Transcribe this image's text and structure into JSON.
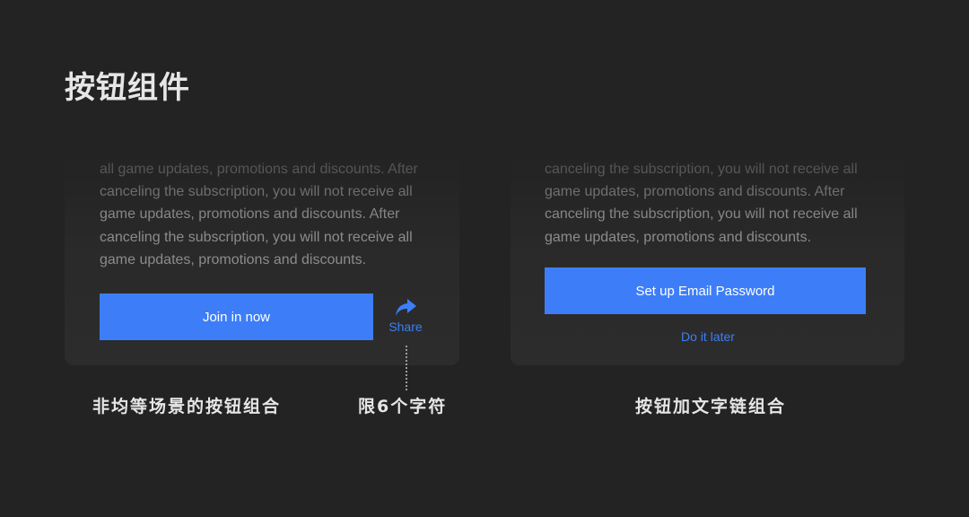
{
  "page": {
    "title": "按钮组件"
  },
  "left_card": {
    "body_lines": [
      "all game updates, promotions and discounts. After",
      "canceling the subscription, you will not receive all",
      "game updates, promotions and discounts. After",
      "canceling the subscription, you will not receive all",
      "game updates, promotions and discounts."
    ],
    "primary_button_label": "Join in now",
    "share_label": "Share",
    "share_icon": "share-arrow-icon"
  },
  "right_card": {
    "body_lines": [
      "canceling the subscription, you will not receive all",
      "game updates, promotions and discounts. After",
      "canceling the subscription, you will not receive all",
      "game updates, promotions and discounts."
    ],
    "primary_button_label": "Set up Email Password",
    "text_link_label": "Do it later"
  },
  "captions": {
    "left": "非均等场景的按钮组合",
    "middle": "限6个字符",
    "right": "按钮加文字链组合"
  },
  "colors": {
    "background": "#232323",
    "card": "#2c2c2c",
    "accent": "#3d7ef8",
    "body_text": "#8c8c8c",
    "caption_text": "#e6e6e6"
  }
}
